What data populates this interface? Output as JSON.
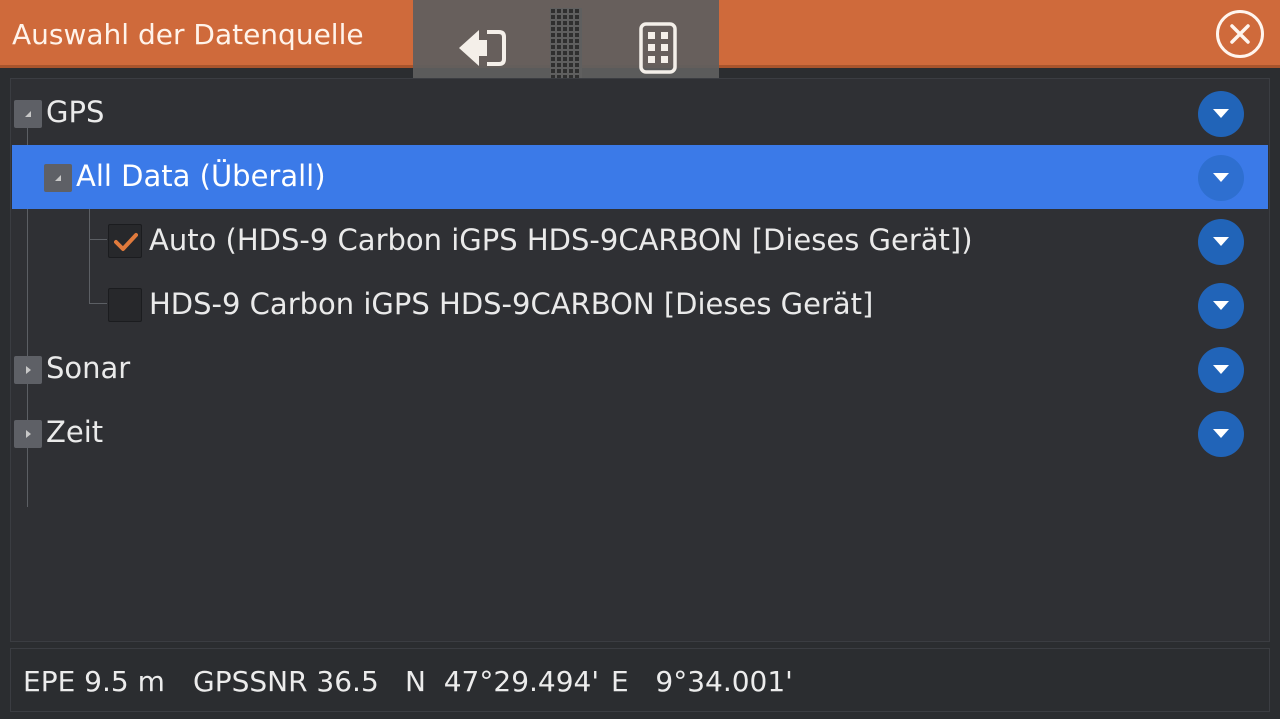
{
  "header": {
    "title": "Auswahl der Datenquelle"
  },
  "toolbar": {
    "icons": [
      "back-arrow-icon",
      "grip-icon",
      "keypad-icon"
    ]
  },
  "tree": {
    "gps": {
      "label": "GPS",
      "expanded": true
    },
    "all_data": {
      "label": "All Data (Überall)",
      "expanded": true,
      "selected": true
    },
    "auto": {
      "label": "Auto (HDS-9 Carbon iGPS HDS-9CARBON [Dieses Gerät])",
      "checked": true
    },
    "device": {
      "label": "HDS-9 Carbon iGPS HDS-9CARBON [Dieses Gerät]",
      "checked": false
    },
    "sonar": {
      "label": "Sonar",
      "expanded": false
    },
    "zeit": {
      "label": "Zeit",
      "expanded": false
    }
  },
  "status": {
    "epe": "EPE 9.5 m",
    "gpssnr": "GPSSNR 36.5",
    "lat": "N  47°29.494'",
    "lon": "E   9°34.001'"
  },
  "colors": {
    "header": "#cf6a3b",
    "selection": "#3b7ae8",
    "dropdown_button": "#2164b8",
    "checkmark": "#e07a3c"
  }
}
